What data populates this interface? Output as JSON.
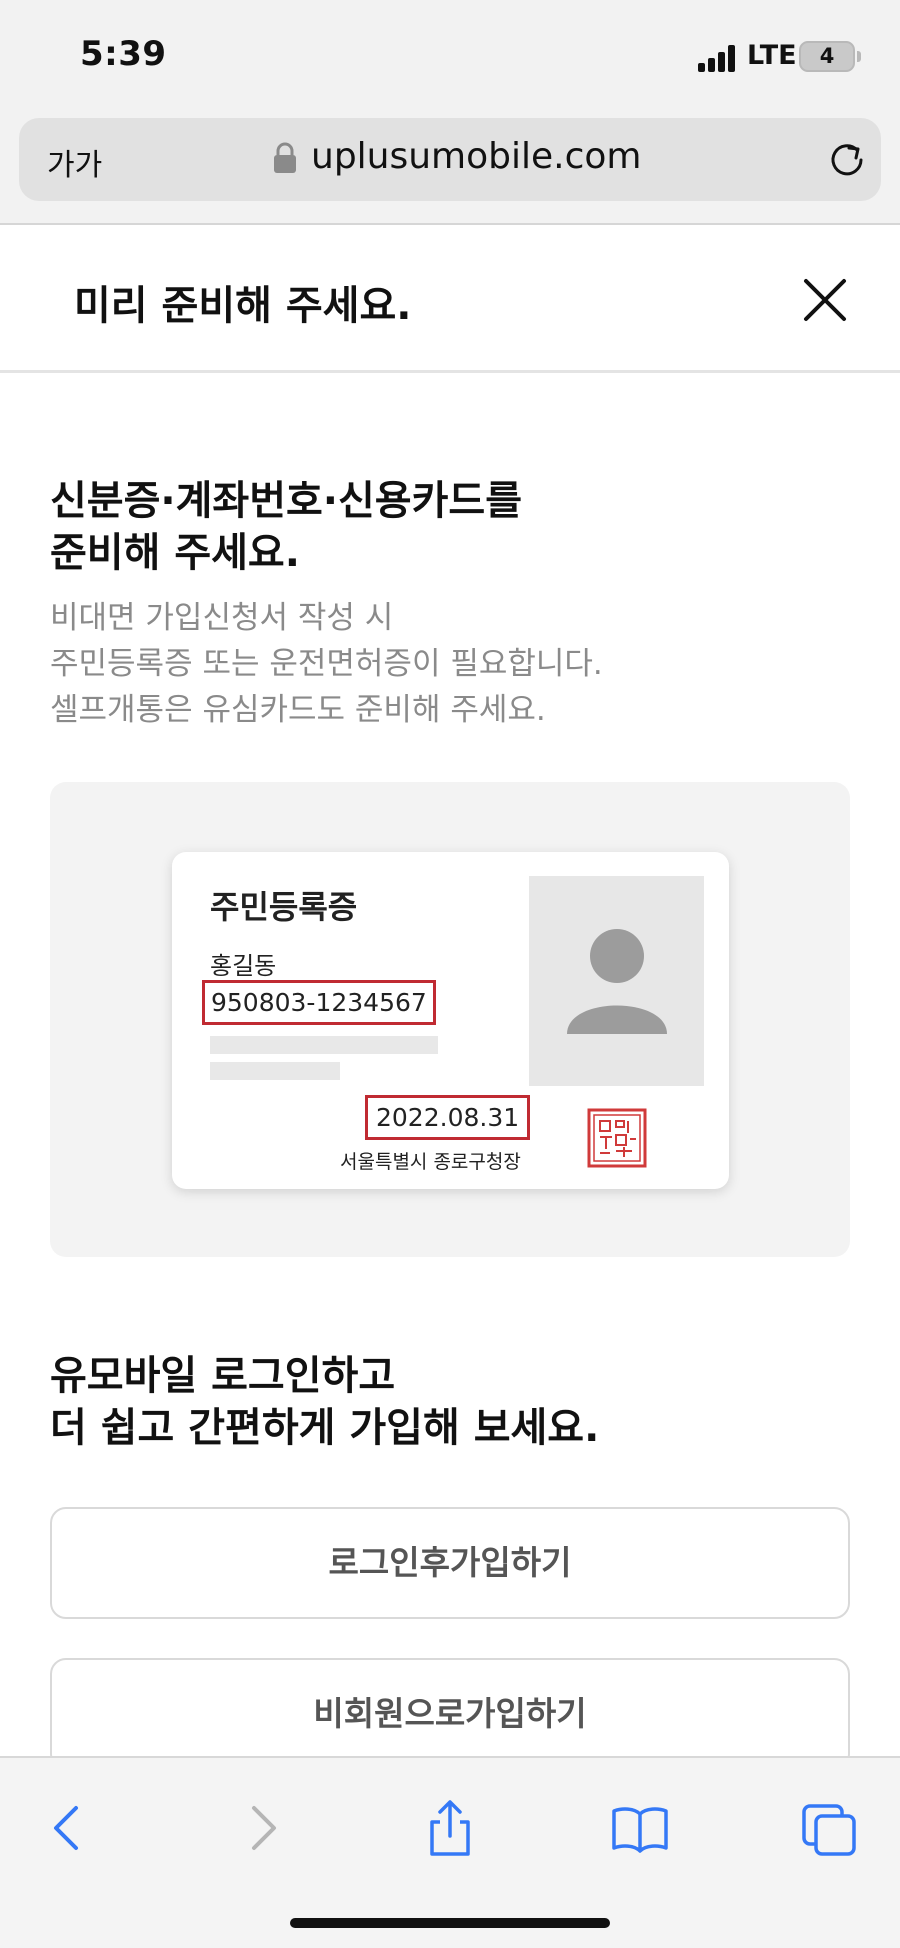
{
  "status_bar": {
    "time": "5:39",
    "network": "LTE",
    "battery": "4"
  },
  "browser": {
    "text_size": "가가",
    "url": "uplusumobile.com"
  },
  "header": {
    "title": "미리 준비해 주세요."
  },
  "section1": {
    "heading_line1": "신분증·계좌번호·신용카드를",
    "heading_line2": "준비해 주세요.",
    "desc_line1": "비대면 가입신청서 작성 시",
    "desc_line2": "주민등록증 또는 운전면허증이 필요합니다.",
    "desc_line3": "셀프개통은 유심카드도 준비해 주세요."
  },
  "id_card": {
    "title": "주민등록증",
    "name": "홍길동",
    "number": "950803-1234567",
    "issue_date": "2022.08.31",
    "issuer": "서울특별시 종로구청장"
  },
  "section2": {
    "heading_line1": "유모바일 로그인하고",
    "heading_line2": "더 쉽고 간편하게 가입해 보세요.",
    "login_button": "로그인후가입하기",
    "guest_button": "비회원으로가입하기"
  },
  "colors": {
    "highlight_red": "#c02a32",
    "safari_blue": "#3478f6"
  }
}
